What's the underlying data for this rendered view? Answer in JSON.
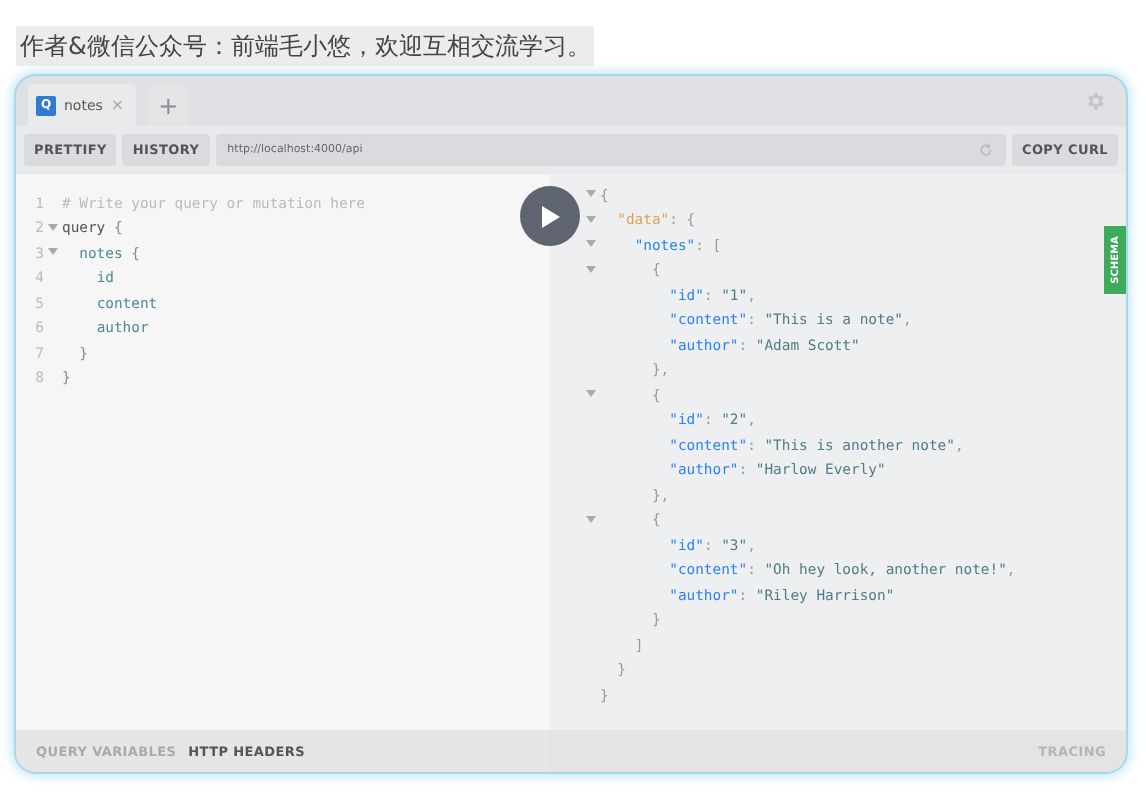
{
  "caption": "作者&微信公众号：前端毛小悠，欢迎互相交流学习。",
  "tabs": [
    {
      "badge": "Q",
      "label": "notes",
      "close": "×",
      "selected": true
    }
  ],
  "new_tab": "+",
  "toolbar": {
    "buttons": [
      "PRETTIFY",
      "HISTORY"
    ],
    "url": "http://localhost:4000/api",
    "copy": "COPY CURL"
  },
  "query_lines": [
    {
      "number": "1",
      "foldable": false,
      "tokens": [
        {
          "t": "# Write your query or mutation here",
          "kind": "comment"
        }
      ]
    },
    {
      "number": "2",
      "foldable": true,
      "tokens": [
        {
          "t": "query",
          "kind": "keyword"
        },
        {
          "t": " {",
          "kind": "punct"
        }
      ]
    },
    {
      "number": "3",
      "foldable": true,
      "tokens": [
        {
          "t": "  notes",
          "kind": "field"
        },
        {
          "t": " {",
          "kind": "punct"
        }
      ]
    },
    {
      "number": "4",
      "foldable": false,
      "tokens": [
        {
          "t": "    id",
          "kind": "field"
        }
      ]
    },
    {
      "number": "5",
      "foldable": false,
      "tokens": [
        {
          "t": "    content",
          "kind": "field"
        }
      ]
    },
    {
      "number": "6",
      "foldable": false,
      "tokens": [
        {
          "t": "    author",
          "kind": "field"
        }
      ]
    },
    {
      "number": "7",
      "foldable": false,
      "tokens": [
        {
          "t": "  }",
          "kind": "punct"
        }
      ]
    },
    {
      "number": "8",
      "foldable": false,
      "tokens": [
        {
          "t": "}",
          "kind": "punct"
        }
      ]
    }
  ],
  "result_lines": [
    {
      "foldable": true,
      "tokens": [
        {
          "t": "{",
          "kind": "punct"
        }
      ]
    },
    {
      "foldable": true,
      "tokens": [
        {
          "t": "  \"data\"",
          "kind": "root"
        },
        {
          "t": ": {",
          "kind": "punct"
        }
      ]
    },
    {
      "foldable": true,
      "tokens": [
        {
          "t": "    \"notes\"",
          "kind": "key"
        },
        {
          "t": ": [",
          "kind": "punct"
        }
      ]
    },
    {
      "foldable": true,
      "tokens": [
        {
          "t": "      {",
          "kind": "punct"
        }
      ]
    },
    {
      "foldable": false,
      "tokens": [
        {
          "t": "        \"id\"",
          "kind": "key"
        },
        {
          "t": ": ",
          "kind": "punct"
        },
        {
          "t": "\"1\"",
          "kind": "string"
        },
        {
          "t": ",",
          "kind": "punct"
        }
      ]
    },
    {
      "foldable": false,
      "tokens": [
        {
          "t": "        \"content\"",
          "kind": "key"
        },
        {
          "t": ": ",
          "kind": "punct"
        },
        {
          "t": "\"This is a note\"",
          "kind": "string"
        },
        {
          "t": ",",
          "kind": "punct"
        }
      ]
    },
    {
      "foldable": false,
      "tokens": [
        {
          "t": "        \"author\"",
          "kind": "key"
        },
        {
          "t": ": ",
          "kind": "punct"
        },
        {
          "t": "\"Adam Scott\"",
          "kind": "string"
        }
      ]
    },
    {
      "foldable": false,
      "tokens": [
        {
          "t": "      },",
          "kind": "punct"
        }
      ]
    },
    {
      "foldable": true,
      "tokens": [
        {
          "t": "      {",
          "kind": "punct"
        }
      ]
    },
    {
      "foldable": false,
      "tokens": [
        {
          "t": "        \"id\"",
          "kind": "key"
        },
        {
          "t": ": ",
          "kind": "punct"
        },
        {
          "t": "\"2\"",
          "kind": "string"
        },
        {
          "t": ",",
          "kind": "punct"
        }
      ]
    },
    {
      "foldable": false,
      "tokens": [
        {
          "t": "        \"content\"",
          "kind": "key"
        },
        {
          "t": ": ",
          "kind": "punct"
        },
        {
          "t": "\"This is another note\"",
          "kind": "string"
        },
        {
          "t": ",",
          "kind": "punct"
        }
      ]
    },
    {
      "foldable": false,
      "tokens": [
        {
          "t": "        \"author\"",
          "kind": "key"
        },
        {
          "t": ": ",
          "kind": "punct"
        },
        {
          "t": "\"Harlow Everly\"",
          "kind": "string"
        }
      ]
    },
    {
      "foldable": false,
      "tokens": [
        {
          "t": "      },",
          "kind": "punct"
        }
      ]
    },
    {
      "foldable": true,
      "tokens": [
        {
          "t": "      {",
          "kind": "punct"
        }
      ]
    },
    {
      "foldable": false,
      "tokens": [
        {
          "t": "        \"id\"",
          "kind": "key"
        },
        {
          "t": ": ",
          "kind": "punct"
        },
        {
          "t": "\"3\"",
          "kind": "string"
        },
        {
          "t": ",",
          "kind": "punct"
        }
      ]
    },
    {
      "foldable": false,
      "tokens": [
        {
          "t": "        \"content\"",
          "kind": "key"
        },
        {
          "t": ": ",
          "kind": "punct"
        },
        {
          "t": "\"Oh hey look, another note!\"",
          "kind": "string"
        },
        {
          "t": ",",
          "kind": "punct"
        }
      ]
    },
    {
      "foldable": false,
      "tokens": [
        {
          "t": "        \"author\"",
          "kind": "key"
        },
        {
          "t": ": ",
          "kind": "punct"
        },
        {
          "t": "\"Riley Harrison\"",
          "kind": "string"
        }
      ]
    },
    {
      "foldable": false,
      "tokens": [
        {
          "t": "      }",
          "kind": "punct"
        }
      ]
    },
    {
      "foldable": false,
      "tokens": [
        {
          "t": "    ]",
          "kind": "punct"
        }
      ]
    },
    {
      "foldable": false,
      "tokens": [
        {
          "t": "  }",
          "kind": "punct"
        }
      ]
    },
    {
      "foldable": false,
      "tokens": [
        {
          "t": "}",
          "kind": "punct"
        }
      ]
    }
  ],
  "schema_tab": "SCHEMA",
  "footer_tabs": [
    {
      "label": "QUERY VARIABLES",
      "selected": false
    },
    {
      "label": "HTTP HEADERS",
      "selected": true
    }
  ],
  "tracing": "TRACING"
}
